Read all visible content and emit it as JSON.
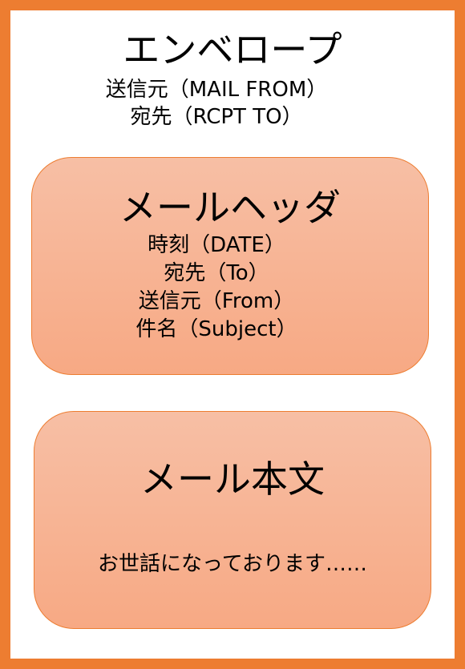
{
  "envelope": {
    "title": "エンベロープ",
    "lines": [
      "送信元（MAIL FROM）",
      "宛先（RCPT TO）"
    ]
  },
  "mail_header": {
    "title": "メールヘッダ",
    "lines": [
      "時刻（DATE）",
      "宛先（To）",
      "送信元（From）",
      "件名（Subject）"
    ]
  },
  "mail_body": {
    "title": "メール本文",
    "text": "お世話になっております……"
  },
  "colors": {
    "frame": "#ED7D31",
    "box_fill_top": "#F7BFA5",
    "box_fill_bottom": "#F7A984",
    "box_border": "#ED7D31"
  }
}
